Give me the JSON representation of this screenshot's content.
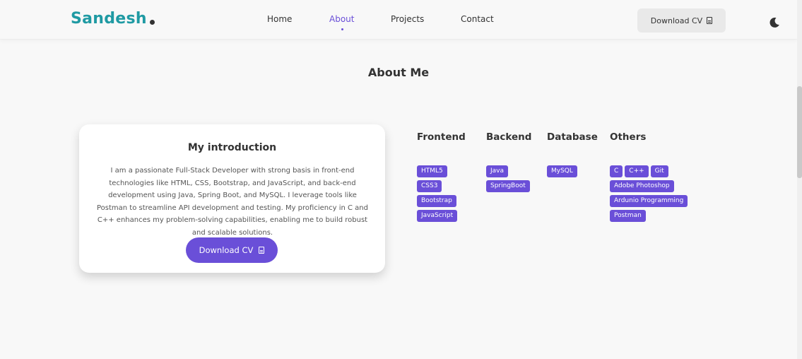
{
  "header": {
    "logo": "Sandesh",
    "nav": [
      {
        "label": "Home",
        "active": false
      },
      {
        "label": "About",
        "active": true
      },
      {
        "label": "Projects",
        "active": false
      },
      {
        "label": "Contact",
        "active": false
      }
    ],
    "download_label": "Download CV",
    "theme_icon": "moon-icon"
  },
  "about": {
    "title": "About Me",
    "intro_title": "My introduction",
    "intro_text": "I am a passionate Full-Stack Developer with strong basis in front-end technologies like HTML, CSS, Bootstrap, and JavaScript, and back-end development using Java, Spring Boot, and MySQL. I leverage tools like Postman to streamline API development and testing. My proficiency in C and C++ enhances my problem-solving capabilities, enabling me to build robust and scalable solutions.",
    "download_label": "Download CV"
  },
  "skills": {
    "frontend": {
      "title": "Frontend",
      "rows": [
        [
          "HTML5"
        ],
        [
          "CSS3"
        ],
        [
          "Bootstrap"
        ],
        [
          "JavaScript"
        ]
      ]
    },
    "backend": {
      "title": "Backend",
      "rows": [
        [
          "Java"
        ],
        [
          "SpringBoot"
        ]
      ]
    },
    "database": {
      "title": "Database",
      "rows": [
        [
          "MySQL"
        ]
      ]
    },
    "others": {
      "title": "Others",
      "rows": [
        [
          "C",
          "C++",
          "Git"
        ],
        [
          "Adobe Photoshop"
        ],
        [
          "Ardunio Programming"
        ],
        [
          "Postman"
        ]
      ]
    }
  },
  "colors": {
    "accent": "#6a4fd8",
    "logo": "#1f9aa3",
    "background": "#f8f8f8"
  }
}
